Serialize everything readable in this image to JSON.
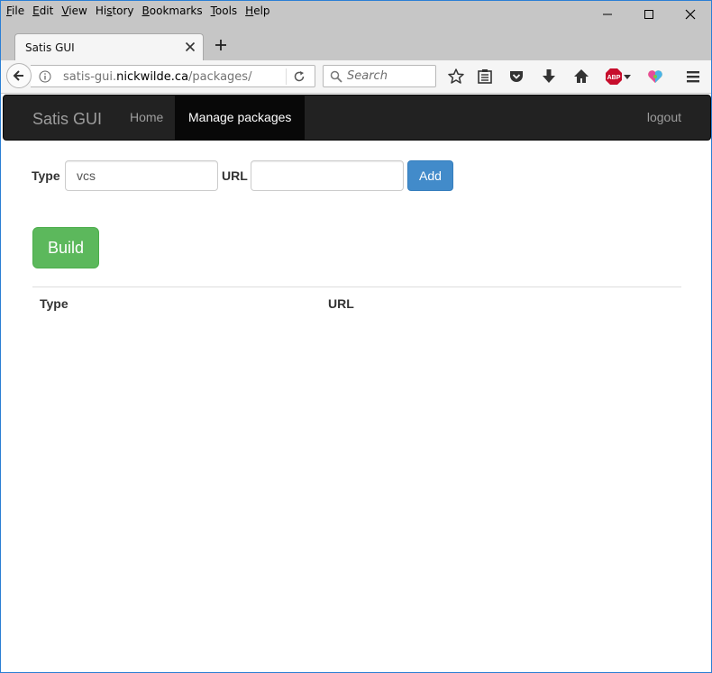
{
  "menu": {
    "items": [
      {
        "accel": "F",
        "rest": "ile"
      },
      {
        "accel": "E",
        "rest": "dit"
      },
      {
        "accel": "V",
        "rest": "iew"
      },
      {
        "pre": "Hi",
        "accel": "s",
        "rest": "tory"
      },
      {
        "accel": "B",
        "rest": "ookmarks"
      },
      {
        "accel": "T",
        "rest": "ools"
      },
      {
        "accel": "H",
        "rest": "elp"
      }
    ]
  },
  "tab": {
    "title": "Satis GUI"
  },
  "address": {
    "prefix": "satis-gui.",
    "host": "nickwilde.ca",
    "path": "/packages/"
  },
  "search": {
    "placeholder": "Search"
  },
  "toolbar_icons": [
    "bookmark-star-icon",
    "reader-list-icon",
    "pocket-icon",
    "download-icon",
    "home-icon",
    "adblock-plus-icon",
    "heart-extension-icon",
    "hamburger-menu-icon"
  ],
  "adblock_badge": "ABP",
  "site": {
    "brand": "Satis GUI",
    "nav": {
      "home": "Home",
      "manage": "Manage packages",
      "logout": "logout"
    }
  },
  "form": {
    "type_label": "Type",
    "type_value": "vcs",
    "url_label": "URL",
    "url_value": "",
    "add_label": "Add"
  },
  "build_label": "Build",
  "table": {
    "headers": [
      "Type",
      "URL"
    ]
  },
  "colors": {
    "add_button": "#428bca",
    "build_button": "#5cb85c",
    "navbar": "#222222",
    "window_border": "#2b7fd4"
  }
}
